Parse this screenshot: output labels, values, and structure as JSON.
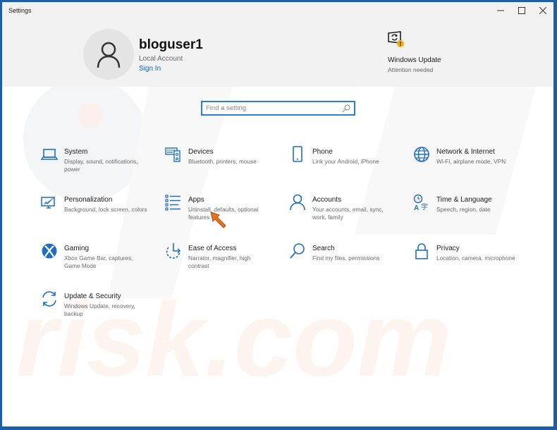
{
  "window": {
    "title": "Settings",
    "controls": {
      "minimize": "—",
      "maximize": "☐",
      "close": "✕"
    }
  },
  "account": {
    "name": "bloguser1",
    "type": "Local Account",
    "sign_in_label": "Sign In"
  },
  "windows_update": {
    "title": "Windows Update",
    "status": "Attention needed"
  },
  "search": {
    "placeholder": "Find a setting",
    "value": ""
  },
  "categories": [
    {
      "id": "system",
      "title": "System",
      "description": "Display, sound, notifications, power",
      "icon": "laptop-icon"
    },
    {
      "id": "devices",
      "title": "Devices",
      "description": "Bluetooth, printers, mouse",
      "icon": "devices-icon"
    },
    {
      "id": "phone",
      "title": "Phone",
      "description": "Link your Android, iPhone",
      "icon": "phone-icon"
    },
    {
      "id": "network",
      "title": "Network & Internet",
      "description": "Wi-Fi, airplane mode, VPN",
      "icon": "globe-icon"
    },
    {
      "id": "personalization",
      "title": "Personalization",
      "description": "Background, lock screen, colors",
      "icon": "paintbrush-icon"
    },
    {
      "id": "apps",
      "title": "Apps",
      "description": "Uninstall, defaults, optional features",
      "icon": "apps-list-icon"
    },
    {
      "id": "accounts",
      "title": "Accounts",
      "description": "Your accounts, email, sync, work, family",
      "icon": "person-icon"
    },
    {
      "id": "time-language",
      "title": "Time & Language",
      "description": "Speech, region, date",
      "icon": "time-language-icon"
    },
    {
      "id": "gaming",
      "title": "Gaming",
      "description": "Xbox Game Bar, captures, Game Mode",
      "icon": "xbox-icon"
    },
    {
      "id": "ease-of-access",
      "title": "Ease of Access",
      "description": "Narrator, magnifier, high contrast",
      "icon": "ease-of-access-icon"
    },
    {
      "id": "search",
      "title": "Search",
      "description": "Find my files, permissions",
      "icon": "magnifier-icon"
    },
    {
      "id": "privacy",
      "title": "Privacy",
      "description": "Location, camera, microphone",
      "icon": "lock-icon"
    },
    {
      "id": "update-security",
      "title": "Update & Security",
      "description": "Windows Update, recovery, backup",
      "icon": "sync-icon"
    }
  ],
  "colors": {
    "accent": "#0067c0",
    "icon_blue": "#1f6fbf",
    "warning": "#f2b200",
    "pointer": "#e8731f"
  }
}
